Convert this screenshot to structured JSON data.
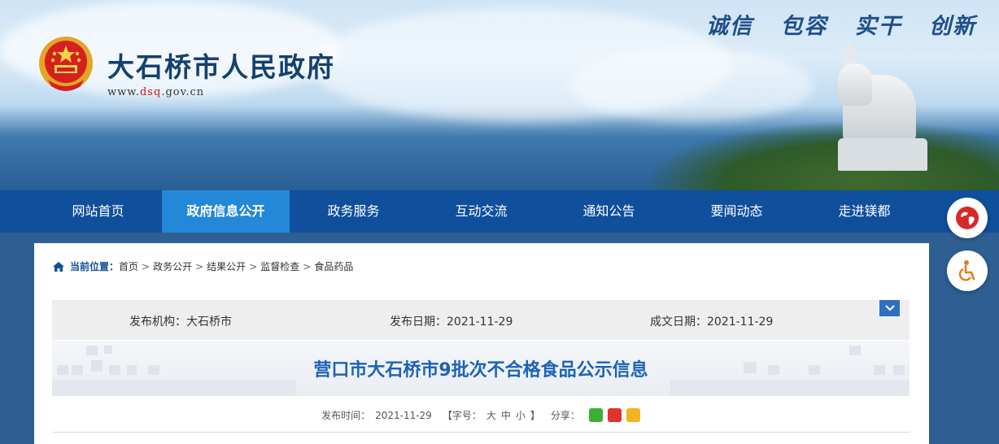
{
  "header": {
    "site_title": "大石桥市人民政府",
    "url_prefix": "www.",
    "url_highlight": "dsq",
    "url_suffix": ".gov.cn",
    "slogan": "诚信 包容 实干 创新"
  },
  "nav": {
    "items": [
      {
        "label": "网站首页"
      },
      {
        "label": "政府信息公开"
      },
      {
        "label": "政务服务"
      },
      {
        "label": "互动交流"
      },
      {
        "label": "通知公告"
      },
      {
        "label": "要闻动态"
      },
      {
        "label": "走进镁都"
      }
    ],
    "active_index": 1
  },
  "breadcrumb": {
    "label": "当前位置：",
    "items": [
      "首页",
      "政务公开",
      "结果公开",
      "监督检查",
      "食品药品"
    ],
    "separator": ">"
  },
  "meta": {
    "publisher_label": "发布机构：",
    "publisher": "大石桥市",
    "publish_date_label": "发布日期：",
    "publish_date": "2021-11-29",
    "doc_date_label": "成文日期：",
    "doc_date": "2021-11-29"
  },
  "article": {
    "title": "营口市大石桥市9批次不合格食品公示信息"
  },
  "info": {
    "time_label": "发布时间：",
    "time": "2021-11-29",
    "font_open": "【字号：",
    "font_large": "大",
    "font_medium": "中",
    "font_small": "小",
    "font_close": "】",
    "share_label": "分享："
  },
  "colors": {
    "nav_bg": "#0f4f9c",
    "nav_active": "#2488d8",
    "title_blue": "#1d62b6",
    "url_red": "#c8161d"
  },
  "icons": [
    "home-icon",
    "chevron-down-icon",
    "wechat-icon",
    "weibo-icon",
    "qzone-icon",
    "globe-icon",
    "accessibility-icon",
    "national-emblem-icon"
  ]
}
